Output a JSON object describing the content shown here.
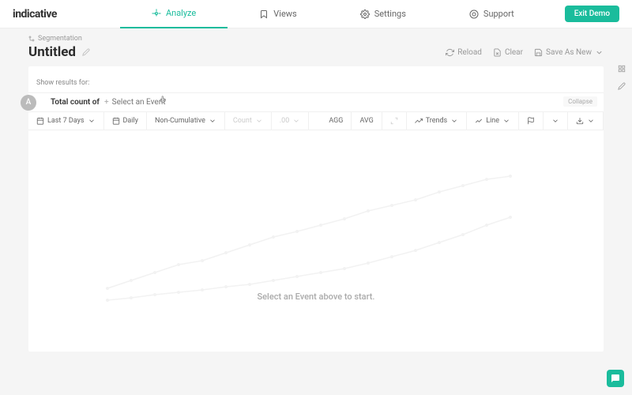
{
  "header": {
    "logo": "indicative",
    "nav": {
      "analyze": "Analyze",
      "views": "Views",
      "settings": "Settings",
      "support": "Support"
    },
    "exit_button": "Exit Demo"
  },
  "breadcrumb": {
    "section": "Segmentation"
  },
  "page": {
    "title": "Untitled"
  },
  "actions": {
    "reload": "Reload",
    "clear": "Clear",
    "save_as_new": "Save As New"
  },
  "filter": {
    "label": "Show results for:"
  },
  "event_row": {
    "badge": "A",
    "label": "Total count of",
    "placeholder": "Select an Event",
    "collapse": "Collapse"
  },
  "toolbar": {
    "date_range": "Last 7 Days",
    "granularity": "Daily",
    "cumulative": "Non-Cumulative",
    "metric": "Count",
    "decimal": ".00",
    "agg": "AGG",
    "avg": "AVG",
    "trends": "Trends",
    "chart_type": "Line"
  },
  "chart": {
    "empty_message": "Select an Event above to start."
  }
}
